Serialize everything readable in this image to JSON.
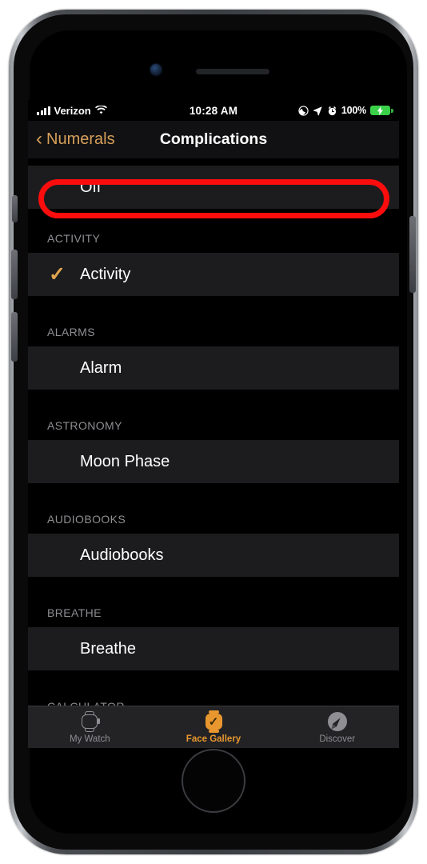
{
  "device": {
    "name": "iphone-8"
  },
  "status_bar": {
    "carrier": "Verizon",
    "time": "10:28 AM",
    "battery_percent": "100%",
    "icons": [
      "signal-bars-icon",
      "wifi-icon",
      "do-not-disturb-icon",
      "location-arrow-icon",
      "alarm-clock-icon",
      "battery-charging-icon"
    ]
  },
  "nav_bar": {
    "back_label": "Numerals",
    "back_chevron": "‹",
    "title": "Complications",
    "back_color": "#d7a05a"
  },
  "annotation": {
    "type": "red-highlight-ring",
    "target": "off-row",
    "color": "#fb0d0d"
  },
  "list": {
    "top_row": {
      "label": "Off",
      "checked": false
    },
    "sections": [
      {
        "header": "ACTIVITY",
        "rows": [
          {
            "label": "Activity",
            "checked": true
          }
        ]
      },
      {
        "header": "ALARMS",
        "rows": [
          {
            "label": "Alarm",
            "checked": false
          }
        ]
      },
      {
        "header": "ASTRONOMY",
        "rows": [
          {
            "label": "Moon Phase",
            "checked": false
          }
        ]
      },
      {
        "header": "AUDIOBOOKS",
        "rows": [
          {
            "label": "Audiobooks",
            "checked": false
          }
        ]
      },
      {
        "header": "BREATHE",
        "rows": [
          {
            "label": "Breathe",
            "checked": false
          }
        ]
      },
      {
        "header": "CALCULATOR",
        "rows": []
      }
    ],
    "check_glyph": "✓",
    "check_color": "#e0a44f"
  },
  "tab_bar": {
    "active_color": "#e8972f",
    "inactive_color": "#8e8e93",
    "tabs": [
      {
        "label": "My Watch",
        "icon": "watch-outline-icon",
        "active": false
      },
      {
        "label": "Face Gallery",
        "icon": "watch-face-icon",
        "active": true
      },
      {
        "label": "Discover",
        "icon": "compass-icon",
        "active": false
      }
    ]
  }
}
